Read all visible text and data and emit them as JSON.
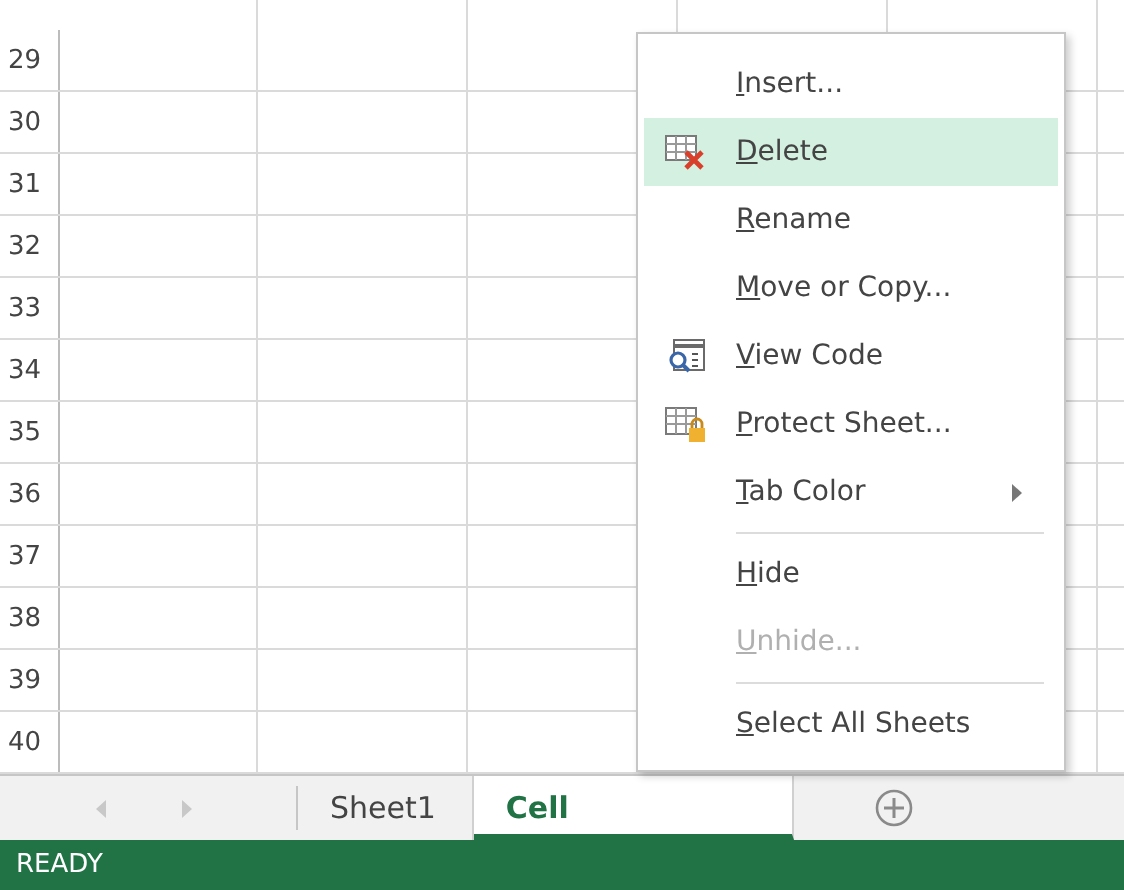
{
  "grid": {
    "row_numbers": [
      "29",
      "30",
      "31",
      "32",
      "33",
      "34",
      "35",
      "36",
      "37",
      "38",
      "39",
      "40"
    ]
  },
  "sheet_tabs": [
    {
      "label": "Sheet1",
      "selected": false
    },
    {
      "label": "Cell",
      "selected": true
    }
  ],
  "context_menu": [
    {
      "kind": "item",
      "label": "Insert...",
      "selected": false,
      "disabled": false
    },
    {
      "kind": "item",
      "label": "Delete",
      "selected": true,
      "disabled": false
    },
    {
      "kind": "item",
      "label": "Rename",
      "selected": false,
      "disabled": false
    },
    {
      "kind": "item",
      "label": "Move or Copy...",
      "selected": false,
      "disabled": false
    },
    {
      "kind": "item",
      "label": "View Code",
      "selected": false,
      "disabled": false
    },
    {
      "kind": "item",
      "label": "Protect Sheet...",
      "selected": false,
      "disabled": false
    },
    {
      "kind": "submenu",
      "label": "Tab Color",
      "selected": false,
      "disabled": false
    },
    {
      "kind": "separator"
    },
    {
      "kind": "item",
      "label": "Hide",
      "selected": false,
      "disabled": false
    },
    {
      "kind": "item",
      "label": "Unhide...",
      "selected": false,
      "disabled": true
    },
    {
      "kind": "separator"
    },
    {
      "kind": "item",
      "label": "Select All Sheets",
      "selected": false,
      "disabled": false
    }
  ],
  "status_bar": {
    "mode": "READY"
  }
}
